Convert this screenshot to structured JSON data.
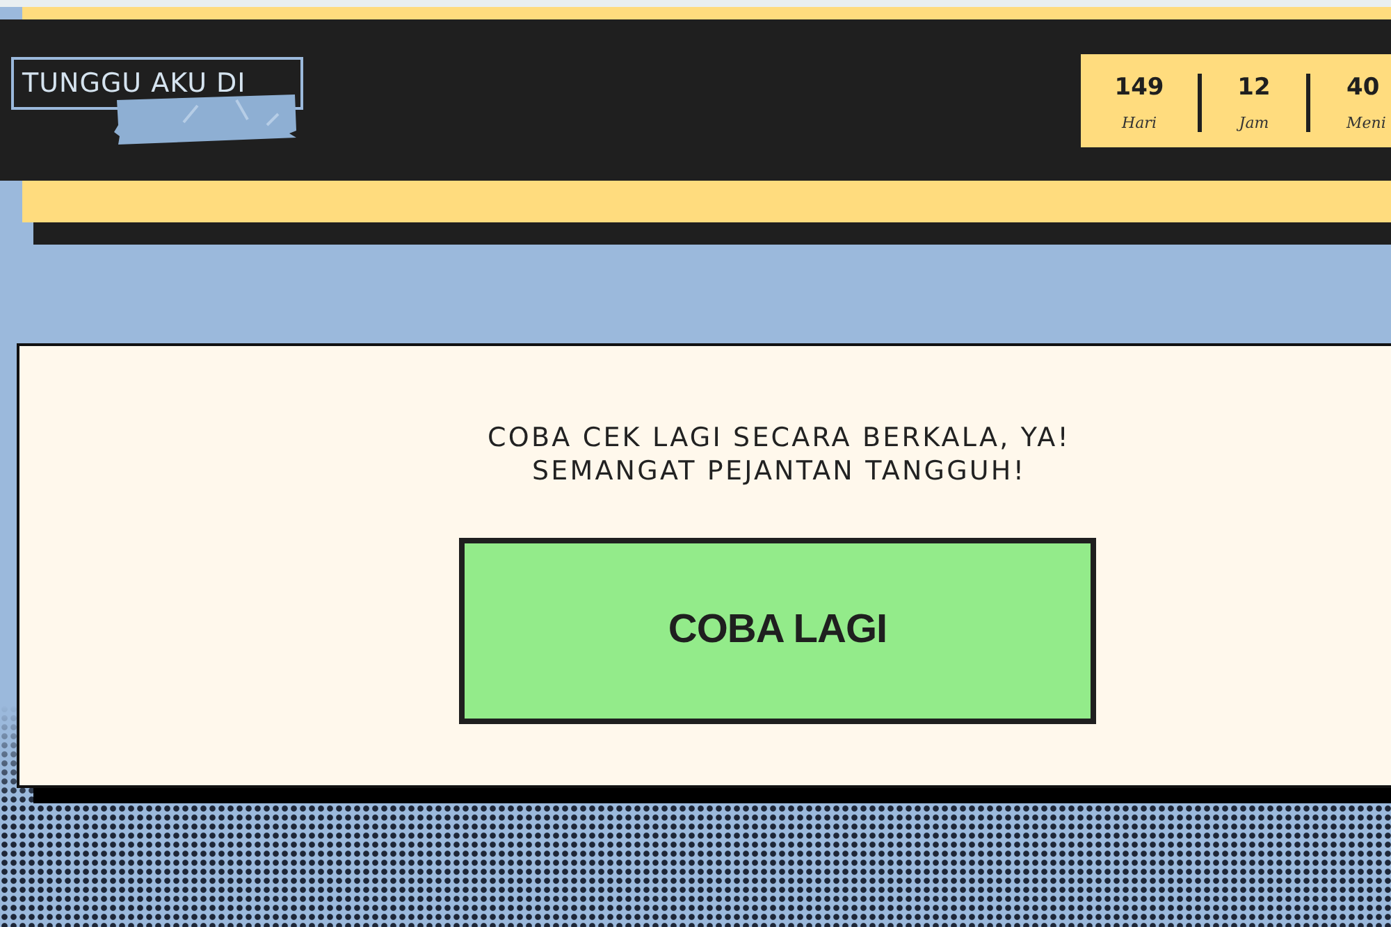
{
  "header": {
    "logo": {
      "text": "TUNGGU AKU DI"
    },
    "countdown": [
      {
        "value": "149",
        "unit": "Hari"
      },
      {
        "value": "12",
        "unit": "Jam"
      },
      {
        "value": "40",
        "unit": "Meni"
      }
    ]
  },
  "message": {
    "lines": [
      "COBA CEK LAGI SECARA BERKALA, YA!",
      "SEMANGAT PEJANTAN TANGGUH!"
    ]
  },
  "button": {
    "label": "COBA LAGI"
  }
}
